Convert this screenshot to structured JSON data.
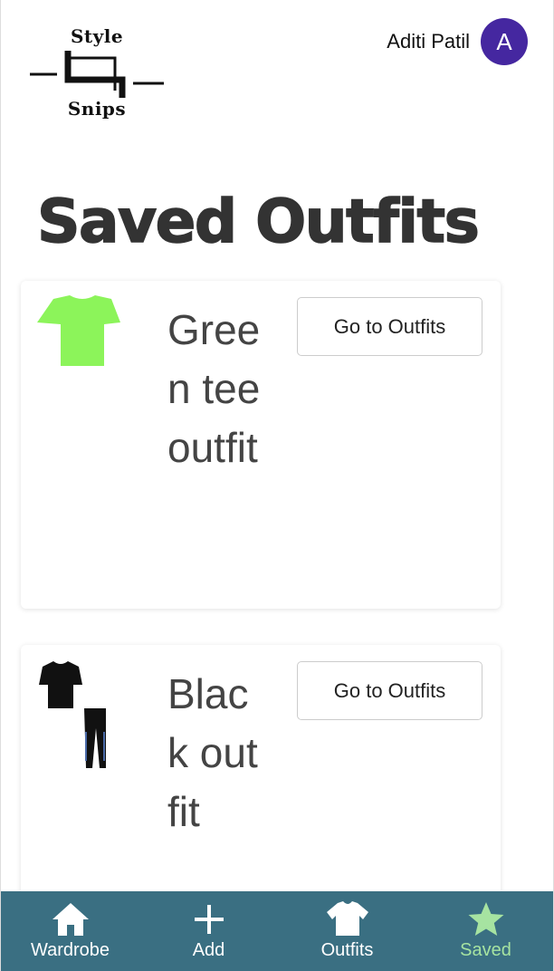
{
  "header": {
    "logo_top": "Style",
    "logo_bottom": "Snips",
    "user_name": "Aditi Patil",
    "avatar_initial": "A"
  },
  "page": {
    "title": "Saved Outfits"
  },
  "outfits": [
    {
      "name": "Green tee outfit",
      "button_label": "Go to Outfits",
      "items": [
        "green-tshirt-image"
      ]
    },
    {
      "name": "Black outfit",
      "button_label": "Go to Outfits",
      "items": [
        "black-tshirt-image",
        "black-pants-image"
      ]
    }
  ],
  "nav": {
    "items": [
      {
        "label": "Wardrobe",
        "icon": "home-icon",
        "active": false
      },
      {
        "label": "Add",
        "icon": "plus-icon",
        "active": false
      },
      {
        "label": "Outfits",
        "icon": "shirt-icon",
        "active": false
      },
      {
        "label": "Saved",
        "icon": "star-icon",
        "active": true
      }
    ],
    "active_color": "#a6e3a1"
  },
  "colors": {
    "nav_bg": "#3a6f82",
    "avatar_bg": "#4527a0",
    "green_tee": "#8cf45a"
  }
}
